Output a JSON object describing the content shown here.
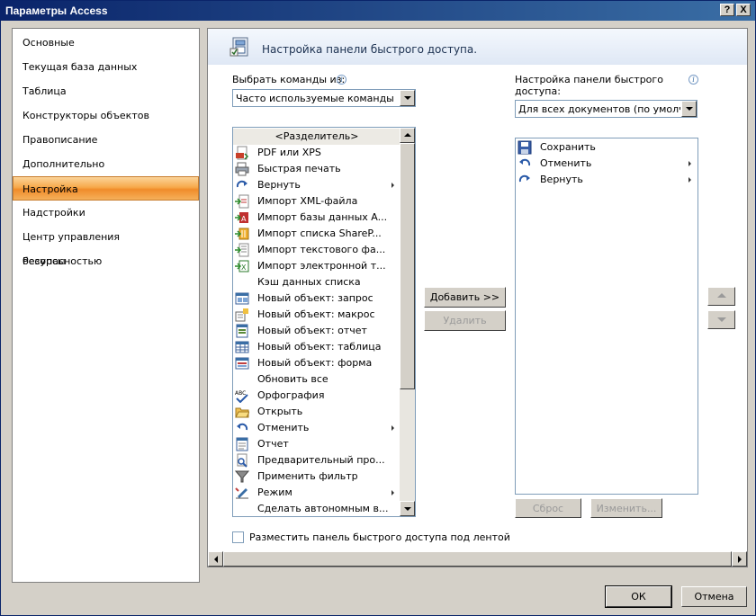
{
  "window": {
    "title": "Параметры Access",
    "help_label": "?",
    "close_label": "X"
  },
  "sidebar": {
    "items": [
      {
        "label": "Основные",
        "selected": false
      },
      {
        "label": "Текущая база данных",
        "selected": false
      },
      {
        "label": "Таблица",
        "selected": false
      },
      {
        "label": "Конструкторы объектов",
        "selected": false
      },
      {
        "label": "Правописание",
        "selected": false
      },
      {
        "label": "Дополнительно",
        "selected": false
      },
      {
        "label": "Настройка",
        "selected": true
      },
      {
        "label": "Надстройки",
        "selected": false
      },
      {
        "label": "Центр управления безопасностью",
        "selected": false
      },
      {
        "label": "Ресурсы",
        "selected": false
      }
    ]
  },
  "header": {
    "title": "Настройка панели быстрого доступа."
  },
  "choose_commands": {
    "label": "Выбрать команды из:",
    "value": "Часто используемые команды"
  },
  "customize_toolbar": {
    "label_line1": "Настройка панели быстрого",
    "label_line2": "доступа:",
    "value": "Для всех документов (по умолч..."
  },
  "commands": [
    {
      "label": "<Разделитель>",
      "icon": "separator",
      "submenu": false
    },
    {
      "label": "PDF или XPS",
      "icon": "pdf-xps-icon",
      "submenu": false
    },
    {
      "label": "Быстрая печать",
      "icon": "quick-print-icon",
      "submenu": false
    },
    {
      "label": "Вернуть",
      "icon": "redo-icon",
      "submenu": true
    },
    {
      "label": "Импорт XML-файла",
      "icon": "import-xml-icon",
      "submenu": false
    },
    {
      "label": "Импорт базы данных A...",
      "icon": "import-access-icon",
      "submenu": false
    },
    {
      "label": "Импорт списка ShareP...",
      "icon": "import-sharepoint-icon",
      "submenu": false
    },
    {
      "label": "Импорт текстового фа...",
      "icon": "import-text-icon",
      "submenu": false
    },
    {
      "label": "Импорт электронной т...",
      "icon": "import-excel-icon",
      "submenu": false
    },
    {
      "label": "Кэш данных списка",
      "icon": "list-cache-icon",
      "submenu": false
    },
    {
      "label": "Новый объект: запрос",
      "icon": "new-query-icon",
      "submenu": false
    },
    {
      "label": "Новый объект: макрос",
      "icon": "new-macro-icon",
      "submenu": false
    },
    {
      "label": "Новый объект: отчет",
      "icon": "new-report-icon",
      "submenu": false
    },
    {
      "label": "Новый объект: таблица",
      "icon": "new-table-icon",
      "submenu": false
    },
    {
      "label": "Новый объект: форма",
      "icon": "new-form-icon",
      "submenu": false
    },
    {
      "label": "Обновить все",
      "icon": "refresh-all-icon",
      "submenu": false
    },
    {
      "label": "Орфография",
      "icon": "spelling-icon",
      "submenu": false
    },
    {
      "label": "Открыть",
      "icon": "open-folder-icon",
      "submenu": false
    },
    {
      "label": "Отменить",
      "icon": "undo-icon",
      "submenu": true
    },
    {
      "label": "Отчет",
      "icon": "report-icon",
      "submenu": false
    },
    {
      "label": "Предварительный про...",
      "icon": "print-preview-icon",
      "submenu": false
    },
    {
      "label": "Применить фильтр",
      "icon": "filter-icon",
      "submenu": false
    },
    {
      "label": "Режим",
      "icon": "view-mode-icon",
      "submenu": true
    },
    {
      "label": "Сделать автономным в...",
      "icon": "offline-icon",
      "submenu": false
    }
  ],
  "toolbar_items": [
    {
      "label": "Сохранить",
      "icon": "save-icon",
      "submenu": false
    },
    {
      "label": "Отменить",
      "icon": "undo-icon",
      "submenu": true
    },
    {
      "label": "Вернуть",
      "icon": "redo-icon",
      "submenu": true
    }
  ],
  "buttons": {
    "add": "Добавить >>",
    "remove": "Удалить",
    "reset": "Сброс",
    "modify": "Изменить...",
    "ok": "ОК",
    "cancel": "Отмена"
  },
  "below_ribbon": {
    "label": "Разместить панель быстрого доступа под лентой",
    "checked": false
  }
}
